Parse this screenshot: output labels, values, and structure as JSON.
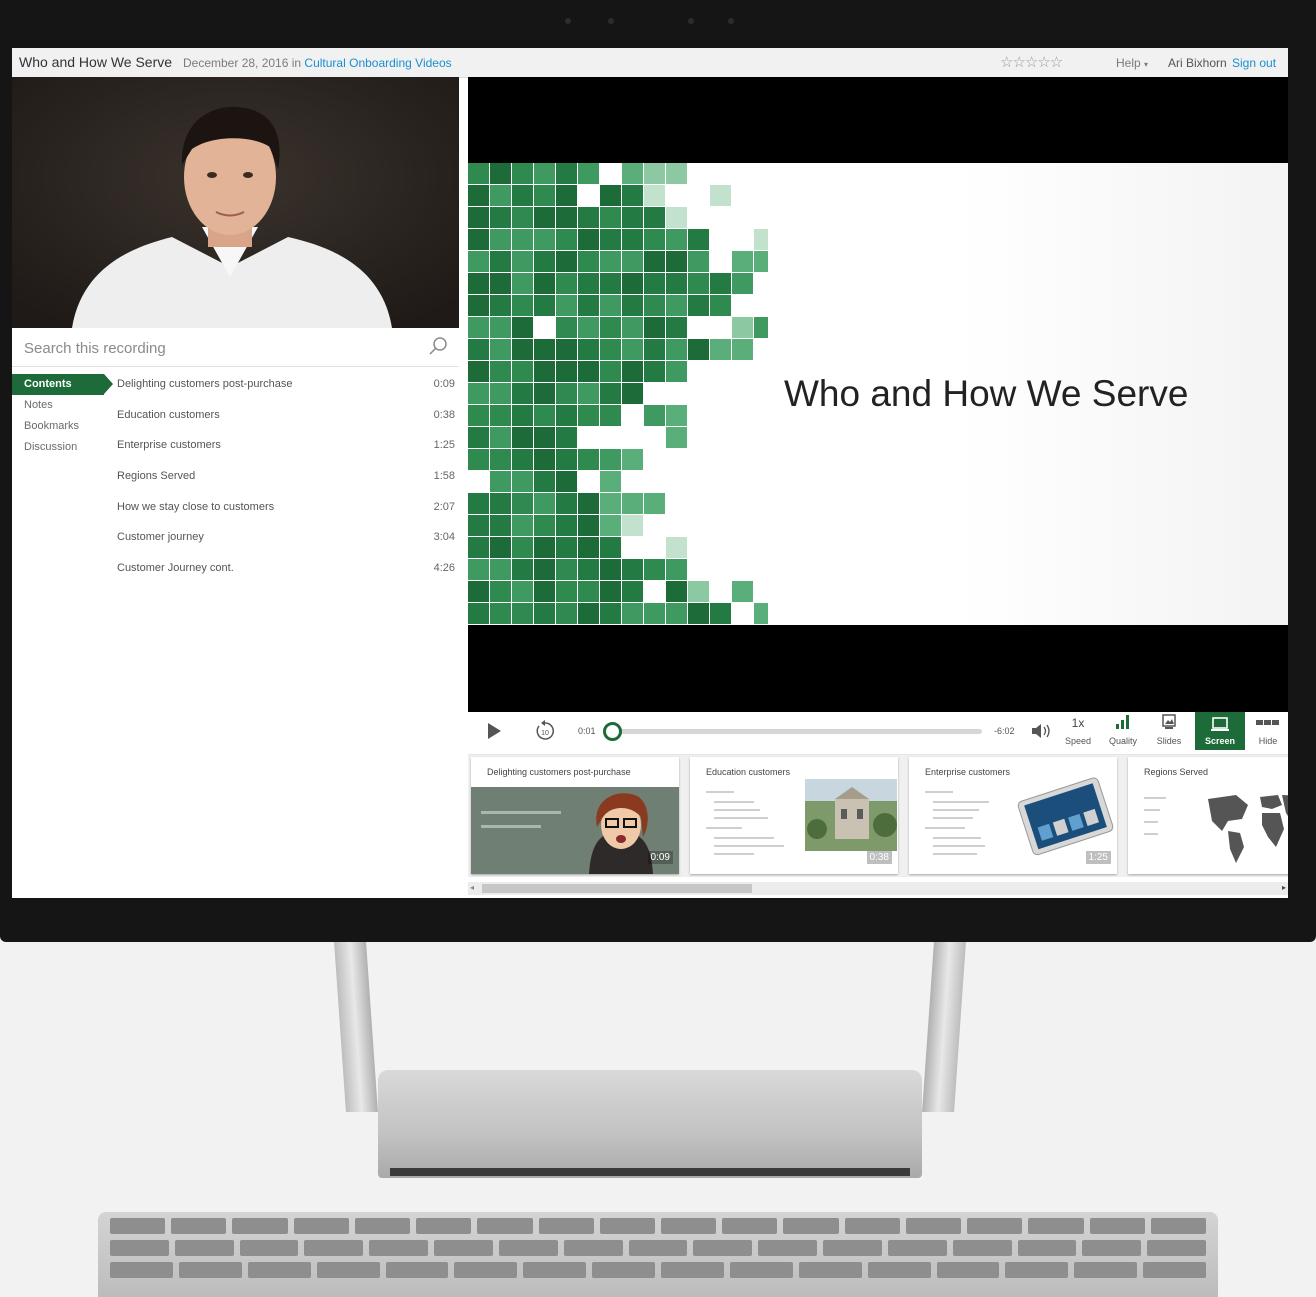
{
  "header": {
    "title": "Who and How We Serve",
    "date_prefix": "December 28, 2016 in",
    "channel": "Cultural Onboarding Videos",
    "rating": "☆☆☆☆☆",
    "help_label": "Help",
    "user_name": "Ari Bixhorn",
    "sign_out": "Sign out"
  },
  "search": {
    "placeholder": "Search this recording"
  },
  "side_tabs": [
    "Contents",
    "Notes",
    "Bookmarks",
    "Discussion"
  ],
  "chapters": [
    {
      "title": "Delighting customers post-purchase",
      "time": "0:09"
    },
    {
      "title": "Education customers",
      "time": "0:38"
    },
    {
      "title": "Enterprise customers",
      "time": "1:25"
    },
    {
      "title": "Regions Served",
      "time": "1:58"
    },
    {
      "title": "How we stay close to customers",
      "time": "2:07"
    },
    {
      "title": "Customer journey",
      "time": "3:04"
    },
    {
      "title": "Customer Journey cont.",
      "time": "4:26"
    }
  ],
  "slide": {
    "title": "Who and How We Serve"
  },
  "controls": {
    "elapsed": "0:01",
    "remaining": "-6:02",
    "progress": 0.003,
    "speed_value": "1x",
    "speed_label": "Speed",
    "quality_label": "Quality",
    "slides_label": "Slides",
    "screen_label": "Screen",
    "hide_label": "Hide"
  },
  "thumbnails": [
    {
      "title": "Delighting customers post-purchase",
      "time": "0:09"
    },
    {
      "title": "Education customers",
      "time": "0:38"
    },
    {
      "title": "Enterprise customers",
      "time": "1:25"
    },
    {
      "title": "Regions Served",
      "time": ""
    }
  ],
  "colors": {
    "accent": "#1c6b39",
    "link": "#1a8fd0"
  }
}
